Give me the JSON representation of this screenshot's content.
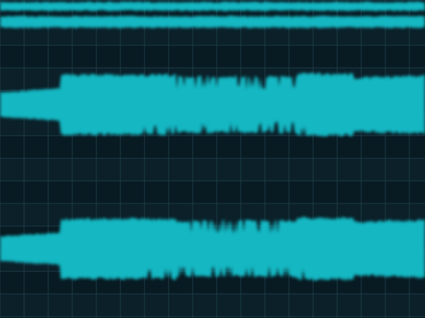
{
  "colors": {
    "background": "#081a22",
    "background_alt": "#0b2029",
    "grid_line": "#1e3c48",
    "waveform": "#14b7c2"
  },
  "tracks": [
    {
      "name": "",
      "kind": "waveform-strip",
      "amplitude_profile": "high-compressed"
    },
    {
      "name": "",
      "kind": "waveform",
      "amplitude_profile": "quiet-intro-then-loud"
    },
    {
      "name": "",
      "kind": "waveform",
      "amplitude_profile": "quiet-intro-then-loud"
    }
  ]
}
